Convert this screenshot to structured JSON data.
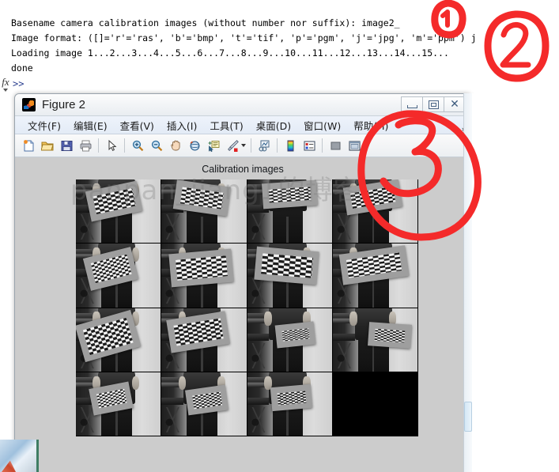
{
  "command_window": {
    "lines": [
      "Basename camera calibration images (without number nor suffix): image2_",
      "Image format: ([]='r'='ras', 'b'='bmp', 't'='tif', 'p'='pgm', 'j'='jpg', 'm'='ppm') j",
      "Loading image 1...2...3...4...5...6...7...8...9...10...11...12...13...14...15...",
      "done"
    ],
    "prompt": ">>",
    "fx_label": "fx"
  },
  "figure": {
    "title": "Figure 2",
    "icon": "matlab-icon",
    "window_controls": [
      {
        "name": "minimize",
        "label": "—"
      },
      {
        "name": "restore",
        "label": "❐"
      },
      {
        "name": "close",
        "label": "✕"
      }
    ],
    "menu": [
      "文件(F)",
      "编辑(E)",
      "查看(V)",
      "插入(I)",
      "工具(T)",
      "桌面(D)",
      "窗口(W)",
      "帮助(H)"
    ],
    "menu_overflow": "»",
    "toolbar": [
      "new-figure-icon",
      "open-file-icon",
      "save-figure-icon",
      "print-figure-icon",
      "sep",
      "edit-pointer-icon",
      "sep",
      "zoom-in-icon",
      "zoom-out-icon",
      "pan-icon",
      "rotate-3d-icon",
      "data-cursor-icon",
      "brush-icon",
      "caret",
      "sep",
      "link-plot-icon",
      "sep",
      "colorbar-icon",
      "legend-icon",
      "sep",
      "hide-plot-tools-icon",
      "show-plot-tools-icon"
    ],
    "axes_title": "Calibration images",
    "watermark": "panpan_jiang1的博客"
  },
  "chart_data": {
    "type": "table",
    "title": "Calibration images",
    "grid": {
      "rows": 4,
      "cols": 4
    },
    "image_count": 15,
    "cells": [
      {
        "index": 1,
        "filled": true,
        "caption": "checkerboard tilted left, upper area"
      },
      {
        "index": 2,
        "filled": true,
        "caption": "checkerboard tilted right, upper area"
      },
      {
        "index": 3,
        "filled": true,
        "caption": "checkerboard near-horizontal, top"
      },
      {
        "index": 4,
        "filled": true,
        "caption": "checkerboard tilted, top right"
      },
      {
        "index": 5,
        "filled": true,
        "caption": "checkerboard rotated counter-clockwise"
      },
      {
        "index": 6,
        "filled": true,
        "caption": "checkerboard large frontal"
      },
      {
        "index": 7,
        "filled": true,
        "caption": "checkerboard dark exposure"
      },
      {
        "index": 8,
        "filled": true,
        "caption": "checkerboard wide angle right"
      },
      {
        "index": 9,
        "filled": true,
        "caption": "checkerboard large tilted left"
      },
      {
        "index": 10,
        "filled": true,
        "caption": "checkerboard large tilted right"
      },
      {
        "index": 11,
        "filled": true,
        "caption": "checkerboard small centered"
      },
      {
        "index": 12,
        "filled": true,
        "caption": "checkerboard small right"
      },
      {
        "index": 13,
        "filled": true,
        "caption": "checkerboard small upper left"
      },
      {
        "index": 14,
        "filled": true,
        "caption": "checkerboard small center"
      },
      {
        "index": 15,
        "filled": true,
        "caption": "checkerboard small center right"
      },
      {
        "index": 16,
        "filled": false,
        "caption": "empty black cell"
      }
    ]
  },
  "annotations": {
    "color": "#f42a2a",
    "marks": [
      {
        "name": "circled-1",
        "label": "1",
        "target": "end of image format line"
      },
      {
        "name": "circled-2",
        "label": "2",
        "target": "right of command window"
      },
      {
        "name": "circled-3",
        "label": "3",
        "target": "figure window upper right"
      }
    ]
  }
}
